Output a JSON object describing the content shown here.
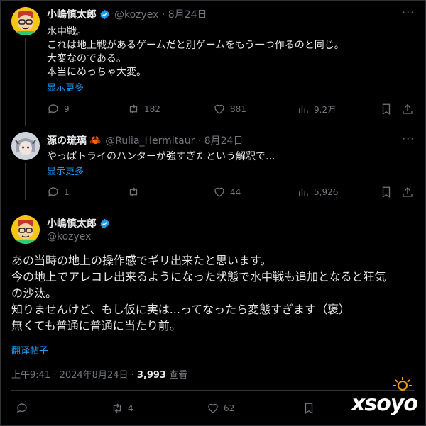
{
  "tweet1": {
    "name": "小嶋慎太郎",
    "handle_date": "@kozyex · 8月24日",
    "lines": [
      "水中戦。",
      "これは地上戦があるゲームだと別ゲームをもう一つ作るのと同じ。",
      "大変なのである。",
      "本当にめっちゃ大変。"
    ],
    "show_more": "显示更多",
    "stats": {
      "reply": "9",
      "retweet": "182",
      "like": "881",
      "views": "9.2万"
    }
  },
  "tweet2": {
    "name": "源の琉璃",
    "handle_date": "@Rulia_Hermitaur · 8月24日",
    "lines": [
      "やっぱトライのハンターが強すぎたという解釈で..."
    ],
    "show_more": "显示更多",
    "stats": {
      "reply": "1",
      "retweet": "",
      "like": "44",
      "views": "5,926"
    }
  },
  "main": {
    "name": "小嶋慎太郎",
    "handle": "@kozyex",
    "lines": [
      "あの当時の地上の操作感でギリ出来たと思います。",
      "今の地上でアレコレ出来るようになった状態で水中戦も追加となると狂気",
      "の沙汰。",
      "知りませんけど、もし仮に実は...ってなったら変態すぎます（褒）",
      "無くても普通に普通に当たり前。"
    ],
    "translate": "翻译帖子",
    "time": "上午9:41 · 2024年8月24日 · ",
    "views_count": "3,993",
    "views_label": " 查看",
    "stats": {
      "reply": "",
      "retweet": "4",
      "like": "62"
    }
  },
  "watermark": "xsoyo",
  "colors": {
    "accent": "#1d9bf0",
    "muted": "#71767b",
    "text": "#e7e9ea",
    "bg": "#000000"
  }
}
